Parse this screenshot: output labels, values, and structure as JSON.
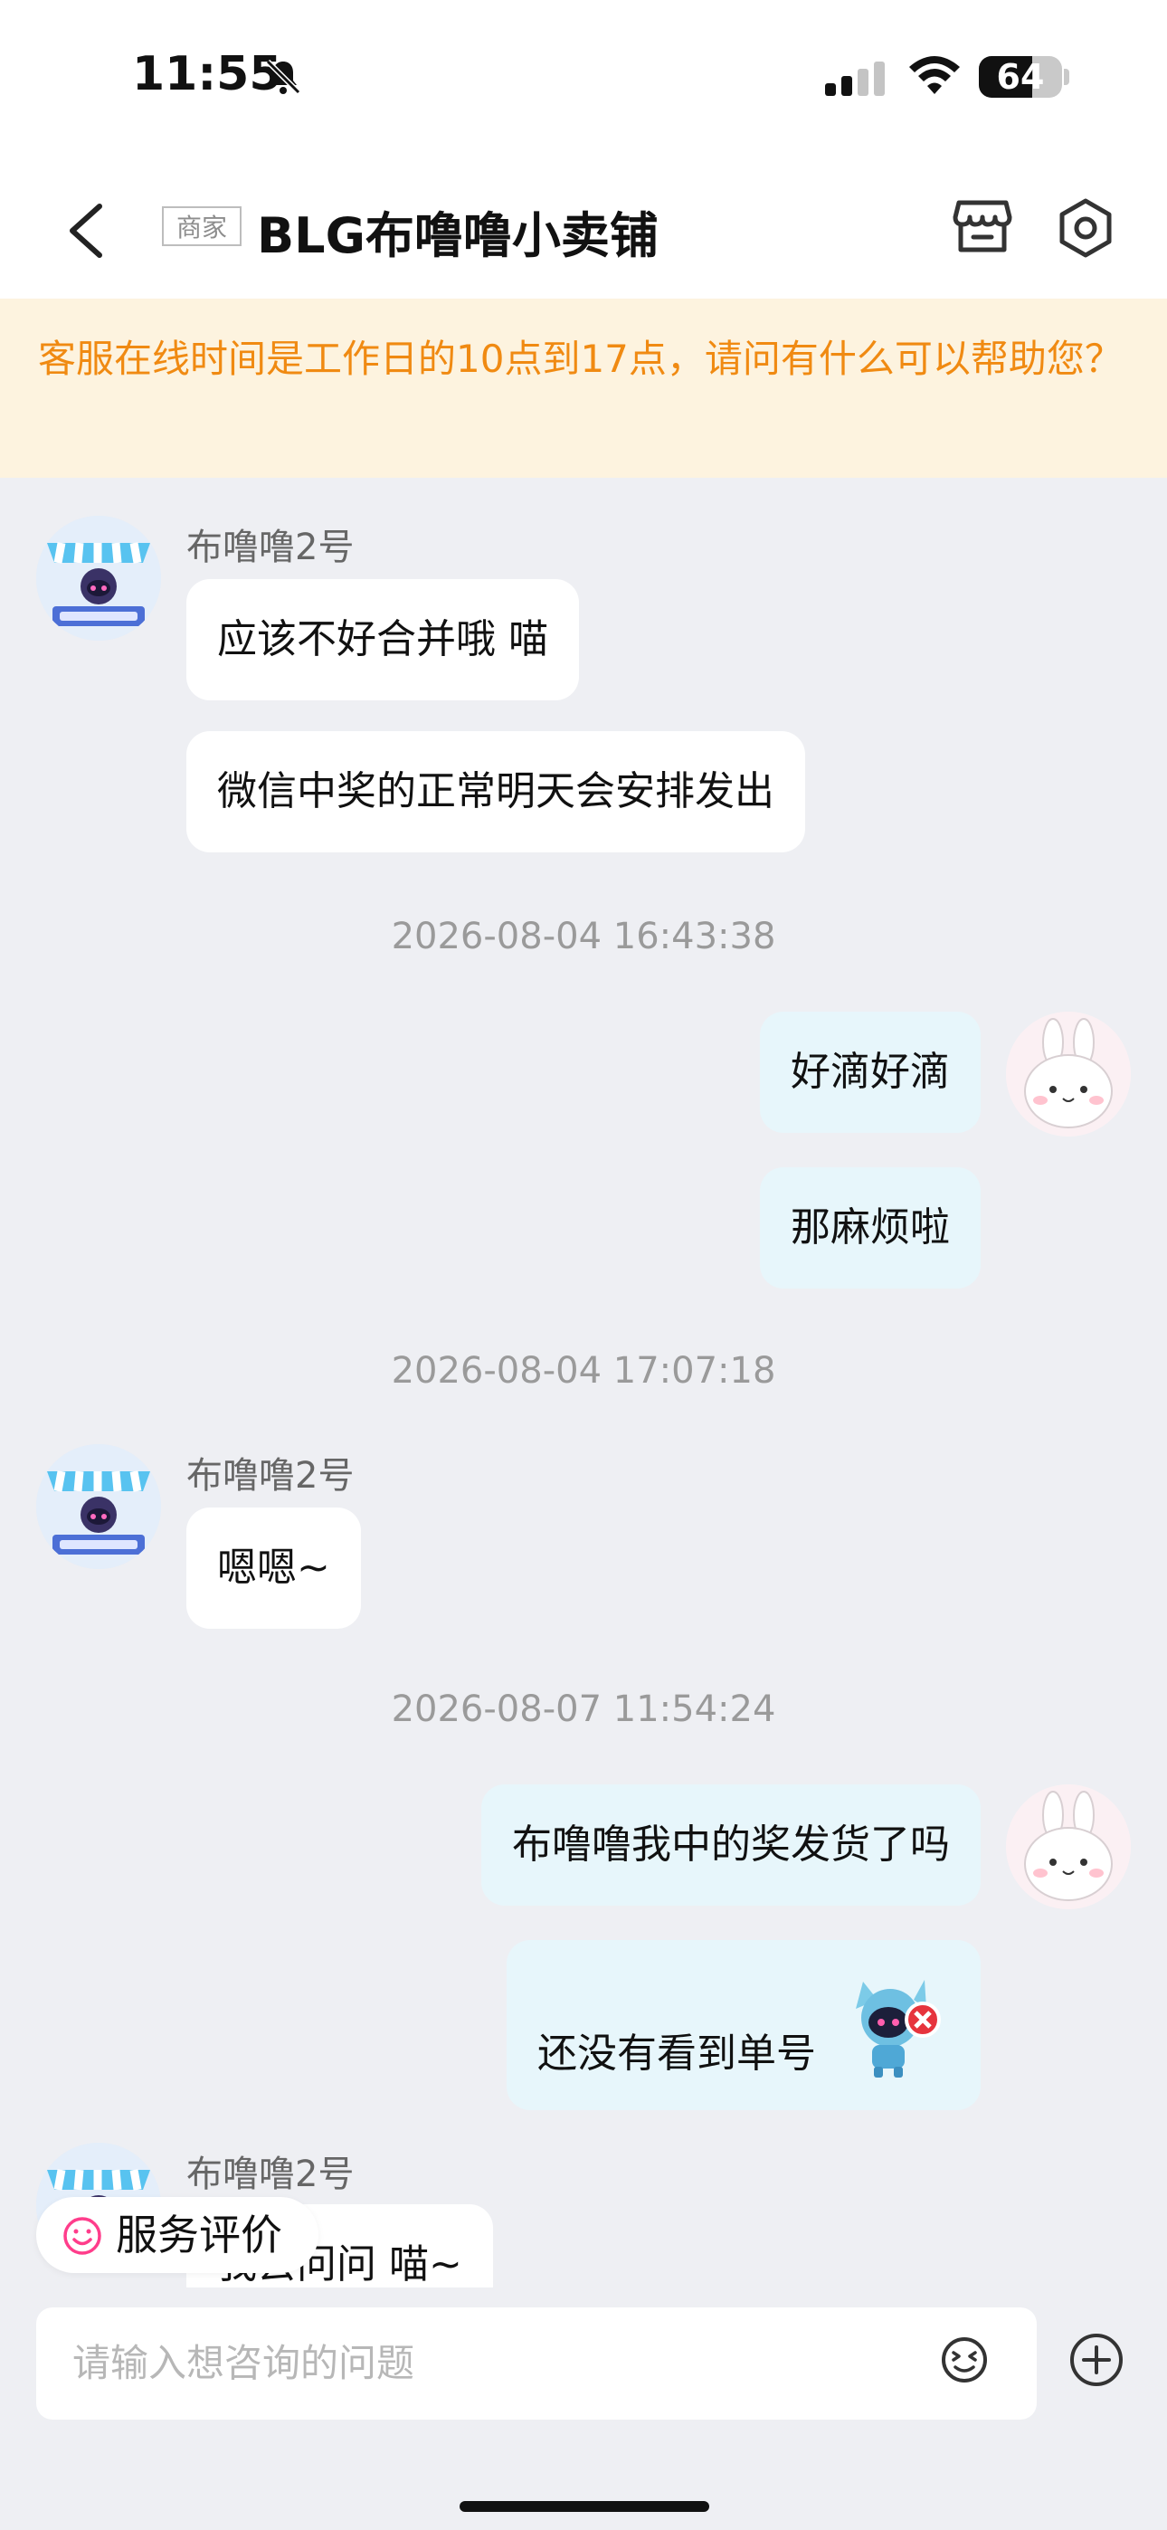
{
  "status_bar": {
    "time": "11:55",
    "battery_level": "64",
    "icons": [
      "bell-muted-icon",
      "signal-icon",
      "wifi-icon",
      "battery-icon"
    ]
  },
  "header": {
    "badge": "商家",
    "title": "BLG布噜噜小卖铺",
    "icons": [
      "back-icon",
      "store-icon",
      "settings-icon"
    ]
  },
  "notice": "客服在线时间是工作日的10点到17点，请问有什么可以帮助您？",
  "messages": {
    "m1_sender": "布噜噜2号",
    "m1_text1": "应该不好合并哦 喵",
    "m1_text2": "微信中奖的正常明天会安排发出",
    "ts1": "2026-08-04 16:43:38",
    "m2_text1": "好滴好滴",
    "m2_text2": "那麻烦啦",
    "ts2": "2026-08-04 17:07:18",
    "m3_sender": "布噜噜2号",
    "m3_text": "嗯嗯~",
    "ts3": "2026-08-07 11:54:24",
    "m4_text1": "布噜噜我中的奖发货了吗",
    "m4_text2": "还没有看到单号",
    "m5_sender": "布噜噜2号",
    "m5_text": "我去问问 喵~"
  },
  "rating_button": "服务评价",
  "input": {
    "placeholder": "请输入想咨询的问题"
  },
  "colors": {
    "notice_text": "#f08a12",
    "notice_bg": "#fdf3df",
    "outgoing_bubble": "#e7f6fb",
    "rating_icon": "#ff3d8b"
  }
}
